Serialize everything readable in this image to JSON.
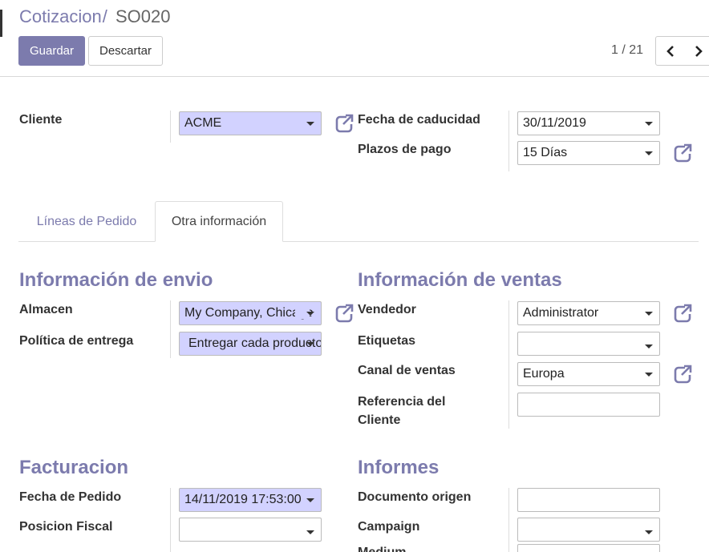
{
  "breadcrumb": {
    "parent": "Cotizacion",
    "separator": "/",
    "current": "SO020"
  },
  "buttons": {
    "save": "Guardar",
    "discard": "Descartar"
  },
  "pager": {
    "value": "1 / 21"
  },
  "header_fields": {
    "customer": {
      "label": "Cliente",
      "value": "ACME"
    },
    "expiration": {
      "label": "Fecha de caducidad",
      "value": "30/11/2019"
    },
    "payment_terms": {
      "label": "Plazos de pago",
      "value": "15 Días"
    }
  },
  "tabs": [
    {
      "label": "Líneas de Pedido"
    },
    {
      "label": "Otra información"
    }
  ],
  "shipping": {
    "title": "Información de envio",
    "warehouse": {
      "label": "Almacen",
      "value": "My Company, Chicago"
    },
    "delivery_policy": {
      "label": "Política de entrega",
      "value": "Entregar cada producto"
    }
  },
  "sales": {
    "title": "Información de ventas",
    "salesperson": {
      "label": "Vendedor",
      "value": "Administrator"
    },
    "tags": {
      "label": "Etiquetas",
      "value": ""
    },
    "sales_channel": {
      "label": "Canal de ventas",
      "value": "Europa"
    },
    "customer_ref": {
      "label_line1": "Referencia del",
      "label_line2": "Cliente",
      "value": ""
    }
  },
  "invoicing": {
    "title": "Facturacion",
    "order_date": {
      "label": "Fecha de Pedido",
      "value": "14/11/2019 17:53:00"
    },
    "fiscal_position": {
      "label": "Posicion Fiscal",
      "value": ""
    }
  },
  "reports": {
    "title": "Informes",
    "source_doc": {
      "label": "Documento origen",
      "value": ""
    },
    "campaign": {
      "label": "Campaign",
      "value": ""
    },
    "medium": {
      "label": "Medium",
      "value": ""
    }
  },
  "colors": {
    "brand": "#7c7bad",
    "required_field": "#d2d2ff"
  },
  "icons": [
    "external-link-icon",
    "chevron-left-icon",
    "chevron-right-icon",
    "caret-down-icon"
  ]
}
